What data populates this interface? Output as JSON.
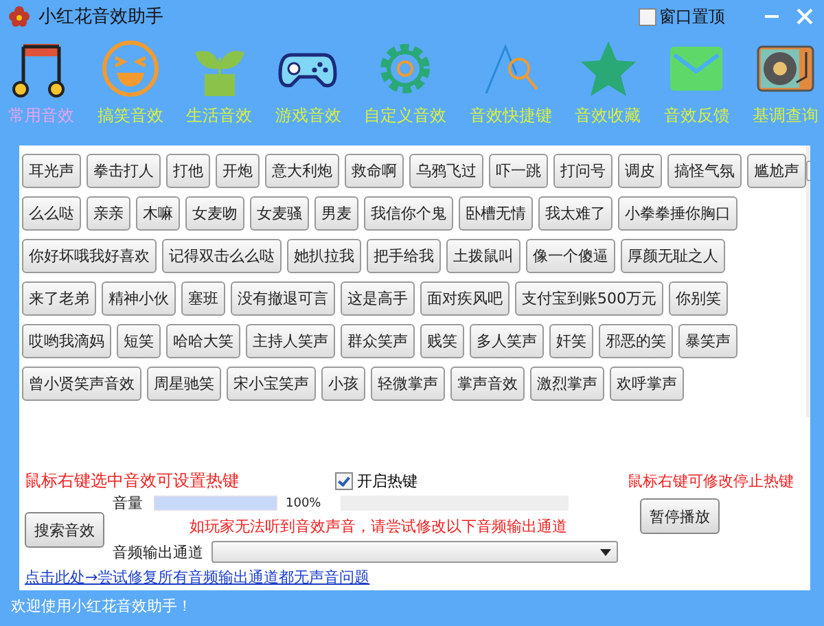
{
  "window": {
    "title": "小红花音效助手",
    "pin_on_top": {
      "label": "窗口置顶",
      "checked": false
    }
  },
  "categories": [
    {
      "label": "常用音效",
      "selected": true
    },
    {
      "label": "搞笑音效",
      "selected": false
    },
    {
      "label": "生活音效",
      "selected": false
    },
    {
      "label": "游戏音效",
      "selected": false
    },
    {
      "label": "自定义音效",
      "selected": false
    },
    {
      "label": "音效快捷键",
      "selected": false
    },
    {
      "label": "音效收藏",
      "selected": false
    },
    {
      "label": "音效反馈",
      "selected": false
    },
    {
      "label": "基调查询",
      "selected": false
    }
  ],
  "sound_rows": [
    [
      "耳光声",
      "拳击打人",
      "打他",
      "开炮",
      "意大利炮",
      "救命啊",
      "乌鸦飞过",
      "吓一跳",
      "打问号",
      "调皮",
      "搞怪气氛",
      "尴尬声"
    ],
    [
      "么么哒",
      "亲亲",
      "木嘛",
      "女麦吻",
      "女麦骚",
      "男麦",
      "我信你个鬼",
      "卧槽无情",
      "我太难了",
      "小拳拳捶你胸口"
    ],
    [
      "你好坏哦我好喜欢",
      "记得双击么么哒",
      "她扒拉我",
      "把手给我",
      "土拨鼠叫",
      "像一个傻逼",
      "厚颜无耻之人"
    ],
    [
      "来了老弟",
      "精神小伙",
      "塞班",
      "没有撤退可言",
      "这是高手",
      "面对疾风吧",
      "支付宝到账500万元",
      "你别笑"
    ],
    [
      "哎哟我滴妈",
      "短笑",
      "哈哈大笑",
      "主持人笑声",
      "群众笑声",
      "贱笑",
      "多人笑声",
      "奸笑",
      "邪恶的笑",
      "暴笑声"
    ],
    [
      "曾小贤笑声音效",
      "周星驰笑",
      "宋小宝笑声",
      "小孩",
      "轻微掌声",
      "掌声音效",
      "激烈掌声",
      "欢呼掌声"
    ]
  ],
  "hotkey_hint": "鼠标右键选中音效可设置热键",
  "enable_hotkey": {
    "label": "开启热键",
    "checked": true
  },
  "stop_hotkey_hint": "鼠标右键可修改停止热键",
  "search_button": "搜索音效",
  "volume": {
    "label": "音量",
    "level": 1.0,
    "reading": "100%"
  },
  "warning": "如玩家无法听到音效声音，请尝试修改以下音频输出通道",
  "pause_button": "暂停播放",
  "output_channel": {
    "label": "音频输出通道"
  },
  "fix_link": "点击此处→尝试修复所有音频输出通道都无声音问题",
  "status_bar": "欢迎使用小红花音效助手！"
}
